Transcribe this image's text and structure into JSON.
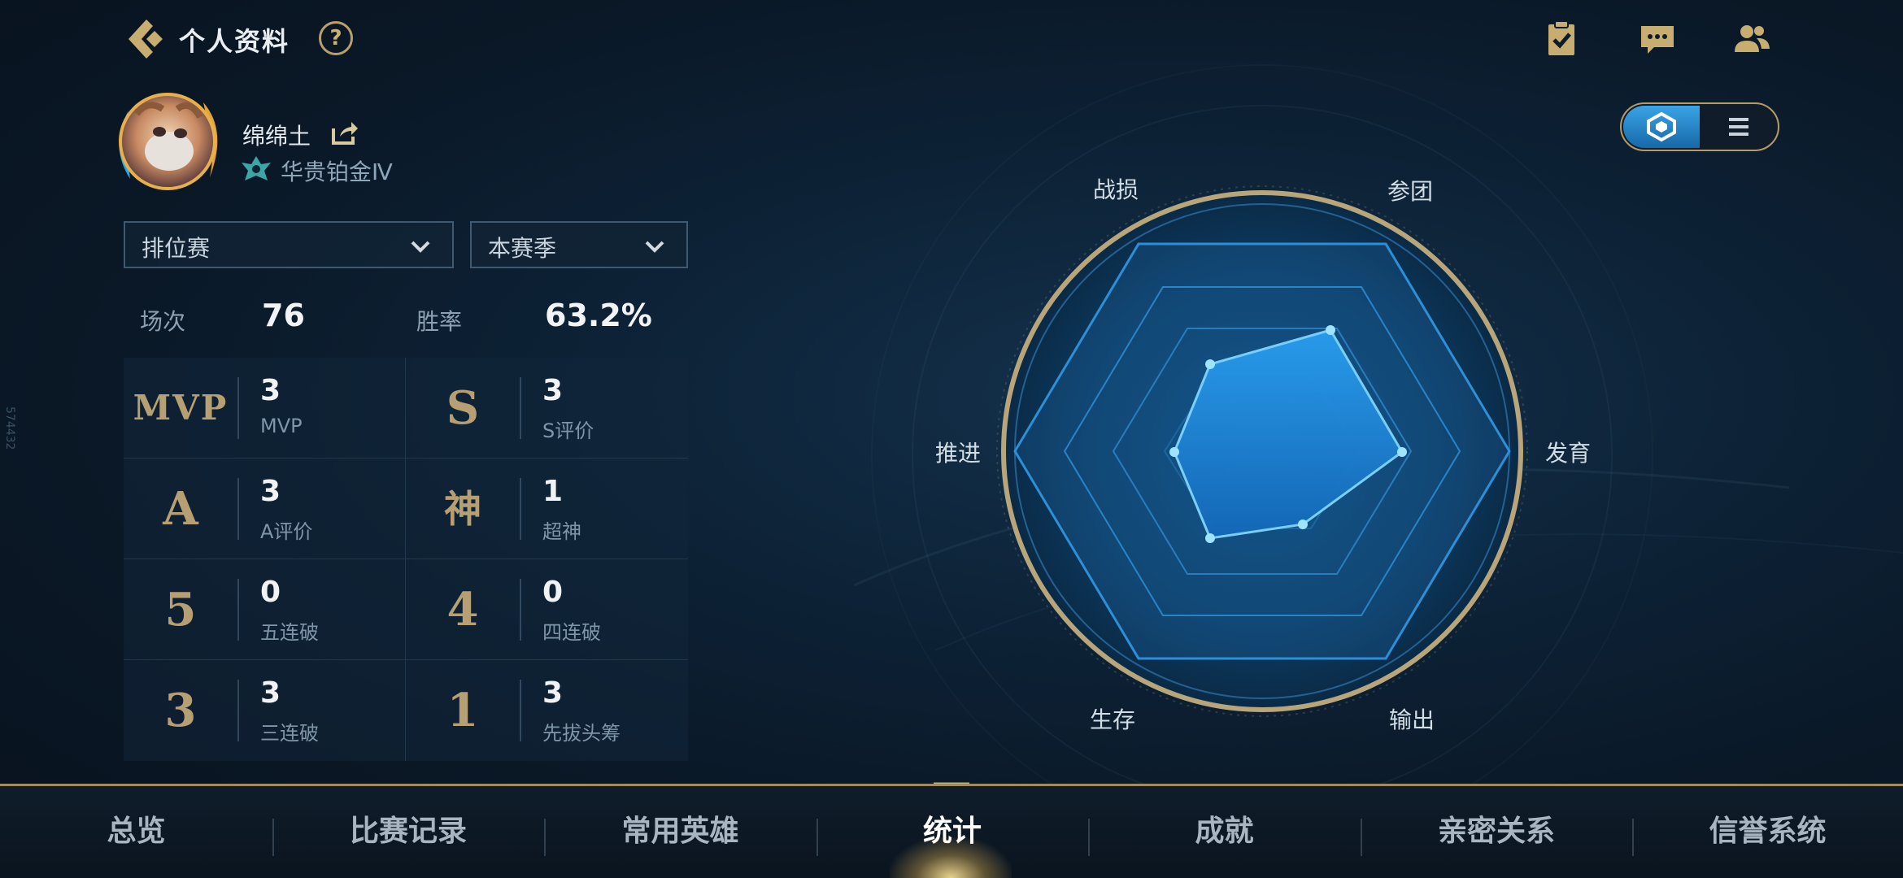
{
  "header": {
    "title": "个人资料",
    "help_glyph": "?"
  },
  "profile": {
    "name": "绵绵土",
    "rank": "华贵铂金Ⅳ"
  },
  "filters": {
    "mode": "排位赛",
    "season": "本赛季"
  },
  "summary": {
    "matches_label": "场次",
    "matches_value": "76",
    "winrate_label": "胜率",
    "winrate_value": "63.2%"
  },
  "stats": [
    {
      "emblem": "MVP",
      "value": "3",
      "label": "MVP"
    },
    {
      "emblem": "S",
      "value": "3",
      "label": "S评价"
    },
    {
      "emblem": "A",
      "value": "3",
      "label": "A评价"
    },
    {
      "emblem": "神",
      "value": "1",
      "label": "超神"
    },
    {
      "emblem": "5",
      "value": "0",
      "label": "五连破"
    },
    {
      "emblem": "4",
      "value": "0",
      "label": "四连破"
    },
    {
      "emblem": "3",
      "value": "3",
      "label": "三连破"
    },
    {
      "emblem": "1",
      "value": "3",
      "label": "先拔头筹"
    }
  ],
  "radar": {
    "labels": {
      "top_left": "战损",
      "top_right": "参团",
      "right": "发育",
      "bottom_right": "输出",
      "bottom_left": "生存",
      "left": "推进"
    },
    "accent": "#3aa4e6"
  },
  "nav": {
    "items": [
      "总览",
      "比赛记录",
      "常用英雄",
      "统计",
      "成就",
      "亲密关系",
      "信誉系统"
    ],
    "active": "统计"
  },
  "side_code": "574432"
}
